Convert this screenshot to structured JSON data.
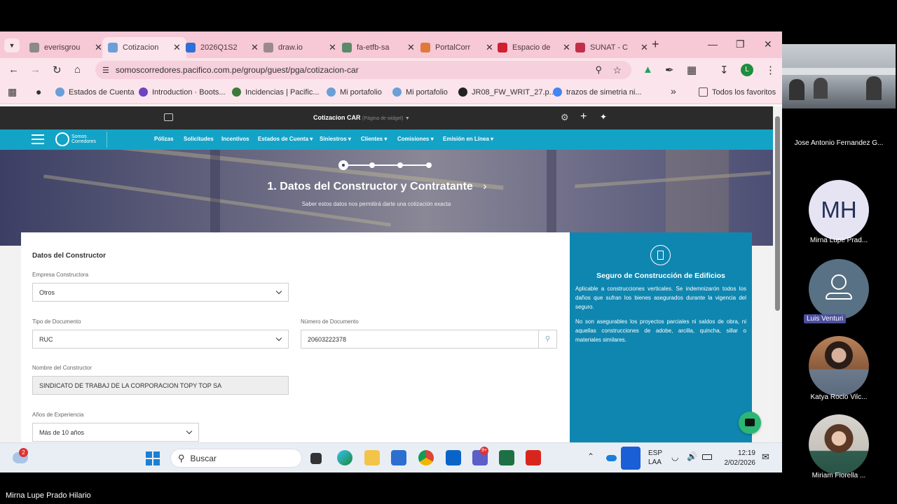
{
  "browser": {
    "tabs": [
      {
        "label": "everisgrou",
        "color": "#8a8a8a"
      },
      {
        "label": "Cotizacion",
        "color": "#6a9fd8"
      },
      {
        "label": "2026Q1S2",
        "color": "#2e6fd8"
      },
      {
        "label": "draw.io",
        "color": "#9a8a90"
      },
      {
        "label": "fa-etfb-sa",
        "color": "#5a8a6a"
      },
      {
        "label": "PortalCorr",
        "color": "#e07a3a"
      },
      {
        "label": "Espacio de",
        "color": "#d02030"
      },
      {
        "label": "SUNAT - C",
        "color": "#c0304a"
      }
    ],
    "url": "somoscorredores.pacifico.com.pe/group/guest/pga/cotizacion-car",
    "profile_initial": "L",
    "bookmarks": [
      "Estados de Cuenta",
      "Introduction · Boots...",
      "Incidencias | Pacific...",
      "Mi portafolio",
      "Mi portafolio",
      "JR08_FW_WRIT_27.p...",
      "trazos de simetria ni..."
    ],
    "bookmarks_more": "»",
    "all_favorites": "Todos los favoritos"
  },
  "widgetbar": {
    "title": "Cotizacion CAR",
    "subtitle": "(Página de widget)"
  },
  "brand": {
    "name": "Somos",
    "name2": "Corredores"
  },
  "nav": {
    "items": [
      "Pólizas",
      "Solicitudes",
      "Incentivos",
      "Estados de Cuenta ▾",
      "Siniestros ▾",
      "Clientes ▾",
      "Comisiones ▾",
      "Emisión en Línea ▾"
    ]
  },
  "hero": {
    "title": "1. Datos del Constructor y Contratante",
    "subtitle": "Saber estos datos nos permitirá darte una cotización exacta",
    "steps_total": 4,
    "step_current": 1
  },
  "form": {
    "section_title": "Datos del Constructor",
    "empresa_label": "Empresa Constructora",
    "empresa_value": "Otros",
    "tipo_doc_label": "Tipo de Documento",
    "tipo_doc_value": "RUC",
    "num_doc_label": "Número de Documento",
    "num_doc_value": "20603222378",
    "nombre_label": "Nombre del Constructor",
    "nombre_value": "SINDICATO DE TRABAJ DE LA CORPORACION TOPY TOP SA",
    "anios_label": "Años de Experiencia",
    "anios_value": "Más de 10 años"
  },
  "info": {
    "title": "Seguro de Construcción de Edificios",
    "p1": "Aplicable a construcciones verticales. Se indemnizarón todos los daños que sufran los bienes asegurados durante la vigencia del seguro.",
    "p2": "No son asegurables los proyectos parciales ni saldos de obra, ni aquellas construcciones de adobe, arcilla, quincha, sillar o materiales similares."
  },
  "taskbar": {
    "search_placeholder": "Buscar",
    "weather_badge": "2",
    "teams_badge": "9+",
    "lang1": "ESP",
    "lang2": "LAA",
    "time": "12:19",
    "date": "2/02/2026"
  },
  "call": {
    "presenter_name": "Mirna Lupe Prado Hilario",
    "participants": [
      {
        "name": "Jose Antonio Fernandez G..."
      },
      {
        "name": "Mirna Lupe Prad...",
        "initials": "MH"
      },
      {
        "name": "Luis Venturi"
      },
      {
        "name": "Katya Rocio Vilc..."
      },
      {
        "name": "Miriam Fiorella ..."
      }
    ]
  },
  "colors": {
    "nav": "#13a3c7",
    "info": "#0f86b0",
    "tabbar": "#f7c8d6"
  }
}
